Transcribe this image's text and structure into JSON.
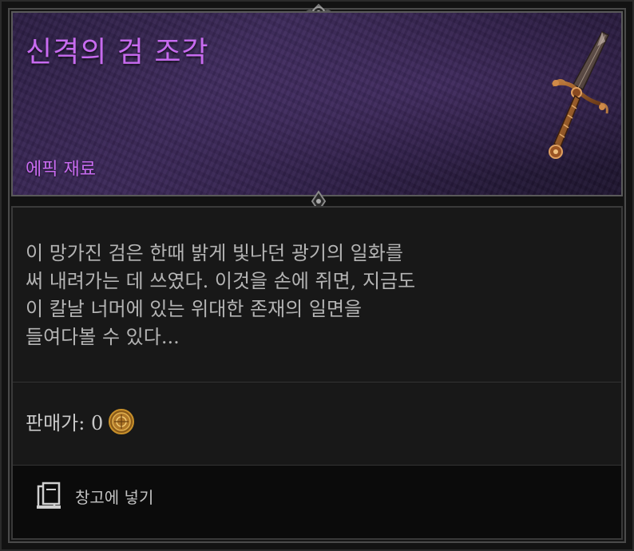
{
  "item": {
    "name": "신격의 검 조각",
    "type": "에픽 재료",
    "description": "이 망가진 검은 한때 밝게 빛나던 광기의 일화를\n써 내려가는 데 쓰였다. 이것을 손에 쥐면, 지금도\n이 칼날 너머에 있는 위대한 존재의 일면을\n들여다볼 수 있다...",
    "icon": "broken-sword-icon"
  },
  "price": {
    "text": "판매가: 0",
    "icon": "gold-coin-icon"
  },
  "actions": {
    "stash_label": "창고에 넣기",
    "stash_icon": "stash-icon"
  },
  "colors": {
    "epic": "#c86bf0",
    "header_bg": "#2d1f45",
    "body_bg": "#181818",
    "text": "#b4b4b4"
  }
}
